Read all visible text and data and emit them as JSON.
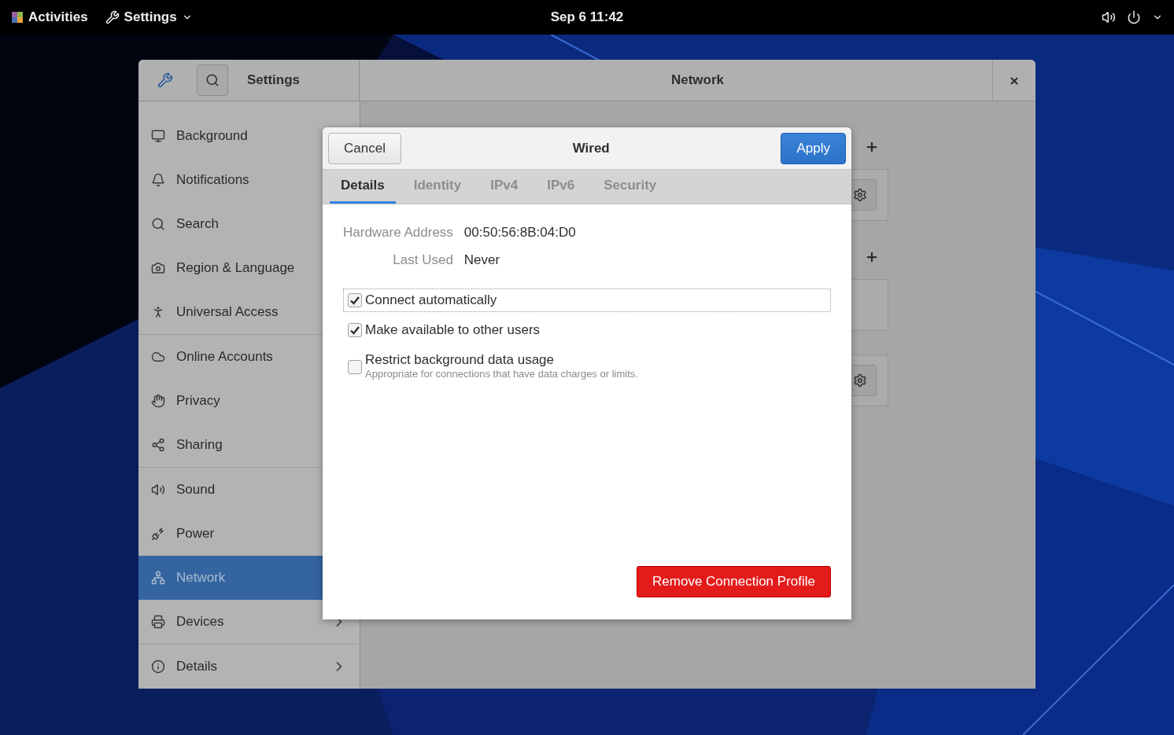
{
  "top_bar": {
    "activities": "Activities",
    "app_menu": "Settings",
    "clock": "Sep 6  11:42"
  },
  "window": {
    "sidebar_title": "Settings",
    "title": "Network",
    "sidebar_groups": [
      {
        "items": [
          {
            "label": "Background",
            "selected": false,
            "submenu": false
          },
          {
            "label": "Notifications",
            "selected": false,
            "submenu": false
          },
          {
            "label": "Search",
            "selected": false,
            "submenu": false
          },
          {
            "label": "Region & Language",
            "selected": false,
            "submenu": false
          },
          {
            "label": "Universal Access",
            "selected": false,
            "submenu": false
          }
        ]
      },
      {
        "items": [
          {
            "label": "Online Accounts",
            "selected": false,
            "submenu": false
          },
          {
            "label": "Privacy",
            "selected": false,
            "submenu": false
          },
          {
            "label": "Sharing",
            "selected": false,
            "submenu": false
          }
        ]
      },
      {
        "items": [
          {
            "label": "Sound",
            "selected": false,
            "submenu": false
          },
          {
            "label": "Power",
            "selected": false,
            "submenu": false
          },
          {
            "label": "Network",
            "selected": true,
            "submenu": false
          },
          {
            "label": "Devices",
            "selected": false,
            "submenu": true
          }
        ]
      },
      {
        "items": [
          {
            "label": "Details",
            "selected": false,
            "submenu": true
          }
        ]
      }
    ],
    "sections": [
      {
        "frames": [
          {
            "settings_button": true
          }
        ]
      },
      {
        "frames": [
          {
            "settings_button": false
          },
          {
            "settings_button": true
          }
        ]
      }
    ]
  },
  "dialog": {
    "title": "Wired",
    "cancel": "Cancel",
    "apply": "Apply",
    "tabs": [
      {
        "label": "Details",
        "selected": true
      },
      {
        "label": "Identity",
        "selected": false
      },
      {
        "label": "IPv4",
        "selected": false
      },
      {
        "label": "IPv6",
        "selected": false
      },
      {
        "label": "Security",
        "selected": false
      }
    ],
    "details": [
      {
        "label": "Hardware Address",
        "value": "00:50:56:8B:04:D0"
      },
      {
        "label": "Last Used",
        "value": "Never"
      }
    ],
    "options": [
      {
        "label": "Connect automatically",
        "checked": true,
        "focused": true
      },
      {
        "label": "Make available to other users",
        "checked": true,
        "focused": false
      },
      {
        "label": "Restrict background data usage",
        "hint": "Appropriate for connections that have data charges or limits.",
        "checked": false,
        "focused": false
      }
    ],
    "remove": "Remove Connection Profile"
  }
}
